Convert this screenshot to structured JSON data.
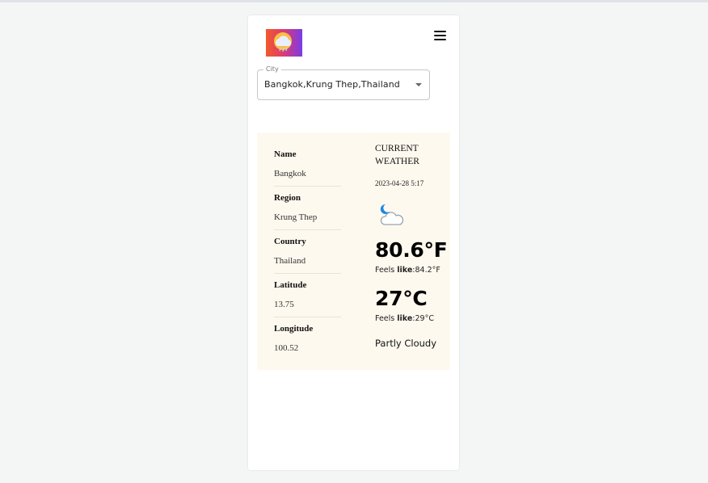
{
  "app": {
    "logo_icon": "rain-cloud-logo-icon",
    "menu_icon": "hamburger-menu-icon"
  },
  "city_select": {
    "label": "City",
    "value": "Bangkok,Krung Thep,Thailand"
  },
  "location": {
    "name_label": "Name",
    "name": "Bangkok",
    "region_label": "Region",
    "region": "Krung Thep",
    "country_label": "Country",
    "country": "Thailand",
    "latitude_label": "Latitude",
    "latitude": "13.75",
    "longitude_label": "Longitude",
    "longitude": "100.52"
  },
  "weather": {
    "title": "CURRENT WEATHER",
    "time": "2023-04-28 5:17",
    "icon": "partly-cloudy-night-icon",
    "temp_f": "80.6°F",
    "feels_prefix": "Feels ",
    "feels_bold": "like",
    "feels_f": ":84.2°F",
    "temp_c": "27°C",
    "feels_c": ":29°C",
    "condition": "Partly Cloudy"
  },
  "colors": {
    "panel_background": "#fef9ef",
    "moon": "#1e88e5"
  }
}
